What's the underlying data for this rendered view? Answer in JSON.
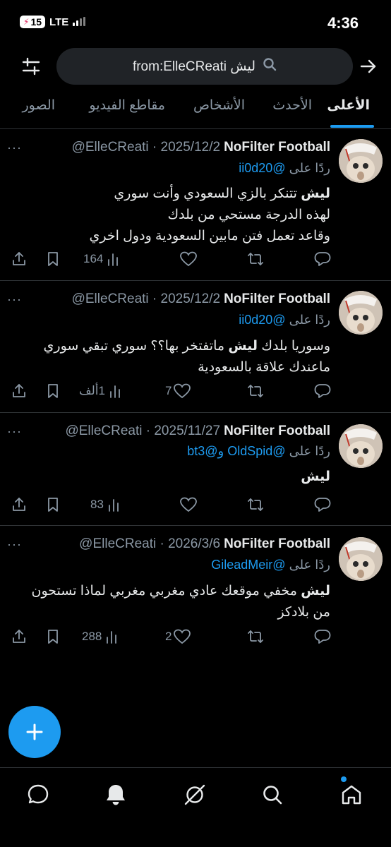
{
  "status_bar": {
    "battery": "15",
    "network": "LTE",
    "time": "4:36"
  },
  "search": {
    "query": "from:ElleCReati ليش",
    "icons": [
      "filter-sliders-icon",
      "search-icon",
      "forward-arrow-icon"
    ]
  },
  "tabs": [
    {
      "label": "الأعلى",
      "active": true
    },
    {
      "label": "الأحدث",
      "active": false
    },
    {
      "label": "الأشخاص",
      "active": false
    },
    {
      "label": "مقاطع الفيديو",
      "active": false
    },
    {
      "label": "الصور",
      "active": false
    }
  ],
  "tweets": [
    {
      "name": "NoFilter Football",
      "meta": "@ElleCReati · 2025/12/2",
      "more": "···",
      "reply_prefix": "ردًا على",
      "reply_mentions": "@ii0d20",
      "text_bold": "ليش",
      "text_rest": "تتنكر بالزي السعودي وأنت سوري",
      "lines": [
        "لهذه الدرجة مستحي من بلدك",
        "وقاعد تعمل فتن مابين السعودية ودول اخري"
      ],
      "views": "164",
      "likes": "",
      "retweets": "",
      "replies": ""
    },
    {
      "name": "NoFilter Football",
      "meta": "@ElleCReati · 2025/12/2",
      "more": "···",
      "reply_prefix": "ردًا على",
      "reply_mentions": "@ii0d20",
      "text_pre": "وسوريا بلدك",
      "text_bold": "ليش",
      "text_rest": "ماتفتخر بها؟؟ سوري تبقي سوري",
      "lines": [
        "ماعندك علاقة بالسعودية"
      ],
      "views": "1ألف",
      "likes": "7",
      "retweets": "",
      "replies": ""
    },
    {
      "name": "NoFilter Football",
      "meta": "@ElleCReati · 2025/11/27",
      "more": "···",
      "reply_prefix": "ردًا على",
      "reply_mentions": "@OldSpid و@bt3",
      "text_bold": "ليش",
      "views": "83",
      "likes": "",
      "retweets": "",
      "replies": ""
    },
    {
      "name": "NoFilter Football",
      "meta": "@ElleCReati · 2026/3/6",
      "more": "···",
      "reply_prefix": "ردًا على",
      "reply_mentions": "@GileadMeir",
      "text_bold": "ليش",
      "text_rest": "مخفي موقعك عادي مغربي مغربي لماذا تستحون",
      "lines": [
        "من بلادكز"
      ],
      "views": "288",
      "likes": "2",
      "retweets": "",
      "replies": ""
    }
  ],
  "fab": {
    "icon": "plus-icon"
  },
  "bottom_nav": [
    "home-icon",
    "search-icon",
    "grok-icon",
    "notifications-bell-icon",
    "messages-icon"
  ],
  "colors": {
    "accent": "#1d9bf0",
    "background": "#000000",
    "secondary_text": "#8b98a5"
  }
}
